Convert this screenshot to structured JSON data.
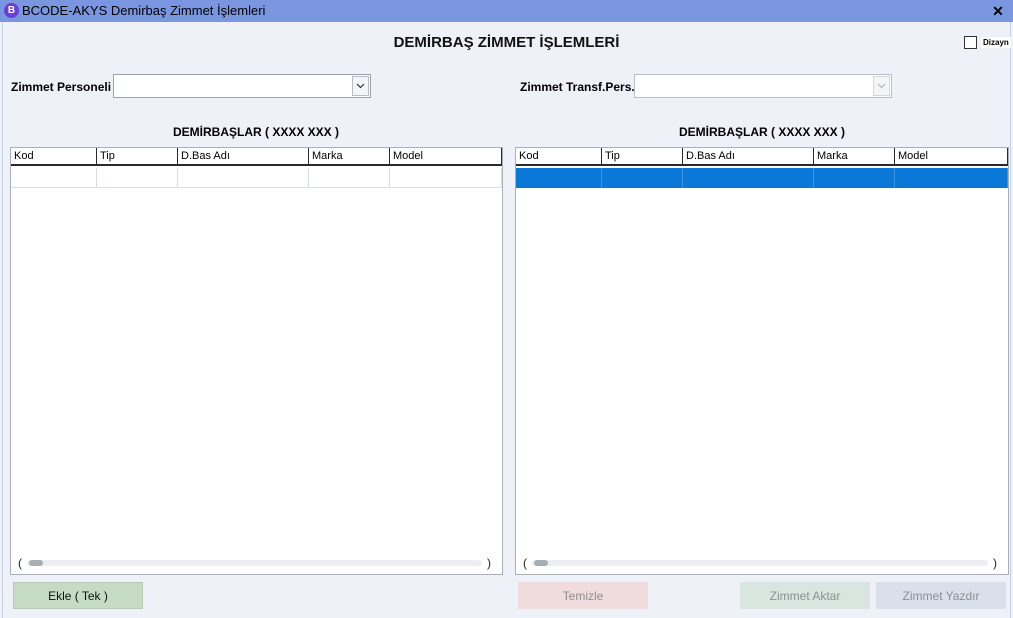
{
  "window": {
    "icon_letter": "B",
    "title": "BCODE-AKYS Demirbaş Zimmet İşlemleri",
    "close_glyph": "✕"
  },
  "page": {
    "title": "DEMİRBAŞ ZİMMET İŞLEMLERİ",
    "dizayn_label": "Dizayn"
  },
  "form": {
    "zimmet_personeli_label": "Zimmet Personeli",
    "zimmet_personeli_value": "",
    "transfer_personeli_label": "Zimmet Transf.Pers.",
    "transfer_personeli_value": ""
  },
  "left_grid": {
    "title": "DEMİRBAŞLAR ( XXXX XXX )",
    "columns": [
      "Kod",
      "Tip",
      "D.Bas Adı",
      "Marka",
      "Model"
    ],
    "rows": [
      [
        "",
        "",
        "",
        "",
        ""
      ]
    ]
  },
  "right_grid": {
    "title": "DEMİRBAŞLAR ( XXXX XXX )",
    "columns": [
      "Kod",
      "Tip",
      "D.Bas Adı",
      "Marka",
      "Model"
    ],
    "rows": [
      [
        "",
        "",
        "",
        "",
        ""
      ]
    ],
    "selected_row": 0
  },
  "scroll": {
    "left_arrow": "(",
    "right_arrow": ")"
  },
  "buttons": {
    "ekle": "Ekle ( Tek )",
    "temizle": "Temizle",
    "zimmet_aktar": "Zimmet Aktar",
    "zimmet_yazdir": "Zimmet Yazdır"
  },
  "icons": {
    "app": "app-logo-icon",
    "close": "close-icon",
    "dropdown": "chevron-down-icon"
  },
  "colors": {
    "titlebar": "#7b96e0",
    "selection": "#0a78d6",
    "ekle_button": "#c5dbc4",
    "temizle_button": "#f0dcdc"
  }
}
